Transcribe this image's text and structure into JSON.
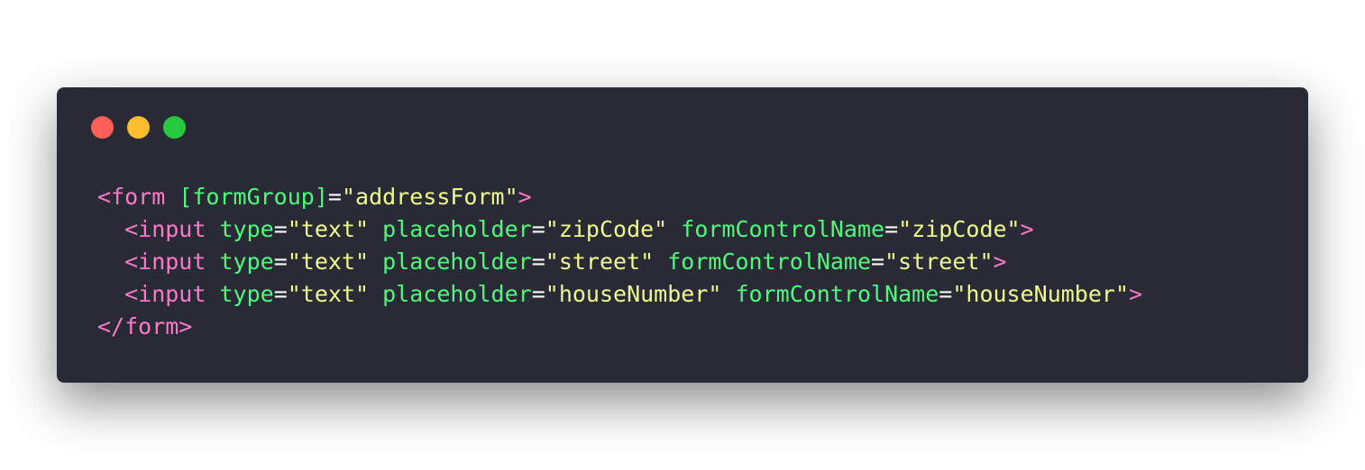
{
  "colors": {
    "background": "#ffffff",
    "window": "#282a36",
    "close": "#ff5f56",
    "minimize": "#ffbd2e",
    "maximize": "#27c93f",
    "tag": "#ff79c6",
    "attr": "#50fa7b",
    "string": "#f1fa8c",
    "plain": "#f8f8f2"
  },
  "window_controls": [
    {
      "name": "close",
      "icon": "red-dot",
      "color": "#ff5f56"
    },
    {
      "name": "minimize",
      "icon": "yellow-dot",
      "color": "#ffbd2e"
    },
    {
      "name": "maximize",
      "icon": "green-dot",
      "color": "#27c93f"
    }
  ],
  "code": {
    "lines": [
      {
        "indent": false,
        "tokens": [
          {
            "type": "tag",
            "text": "<form"
          },
          {
            "type": "plain",
            "text": " "
          },
          {
            "type": "attr",
            "text": "[formGroup]"
          },
          {
            "type": "plain",
            "text": "="
          },
          {
            "type": "string",
            "text": "\"addressForm\""
          },
          {
            "type": "tag",
            "text": ">"
          }
        ]
      },
      {
        "indent": true,
        "tokens": [
          {
            "type": "tag",
            "text": "<input"
          },
          {
            "type": "plain",
            "text": " "
          },
          {
            "type": "attr",
            "text": "type"
          },
          {
            "type": "plain",
            "text": "="
          },
          {
            "type": "string",
            "text": "\"text\""
          },
          {
            "type": "plain",
            "text": " "
          },
          {
            "type": "attr",
            "text": "placeholder"
          },
          {
            "type": "plain",
            "text": "="
          },
          {
            "type": "string",
            "text": "\"zipCode\""
          },
          {
            "type": "plain",
            "text": " "
          },
          {
            "type": "attr",
            "text": "formControlName"
          },
          {
            "type": "plain",
            "text": "="
          },
          {
            "type": "string",
            "text": "\"zipCode\""
          },
          {
            "type": "tag",
            "text": ">"
          }
        ]
      },
      {
        "indent": true,
        "tokens": [
          {
            "type": "tag",
            "text": "<input"
          },
          {
            "type": "plain",
            "text": " "
          },
          {
            "type": "attr",
            "text": "type"
          },
          {
            "type": "plain",
            "text": "="
          },
          {
            "type": "string",
            "text": "\"text\""
          },
          {
            "type": "plain",
            "text": " "
          },
          {
            "type": "attr",
            "text": "placeholder"
          },
          {
            "type": "plain",
            "text": "="
          },
          {
            "type": "string",
            "text": "\"street\""
          },
          {
            "type": "plain",
            "text": " "
          },
          {
            "type": "attr",
            "text": "formControlName"
          },
          {
            "type": "plain",
            "text": "="
          },
          {
            "type": "string",
            "text": "\"street\""
          },
          {
            "type": "tag",
            "text": ">"
          }
        ]
      },
      {
        "indent": true,
        "tokens": [
          {
            "type": "tag",
            "text": "<input"
          },
          {
            "type": "plain",
            "text": " "
          },
          {
            "type": "attr",
            "text": "type"
          },
          {
            "type": "plain",
            "text": "="
          },
          {
            "type": "string",
            "text": "\"text\""
          },
          {
            "type": "plain",
            "text": " "
          },
          {
            "type": "attr",
            "text": "placeholder"
          },
          {
            "type": "plain",
            "text": "="
          },
          {
            "type": "string",
            "text": "\"houseNumber\""
          },
          {
            "type": "plain",
            "text": " "
          },
          {
            "type": "attr",
            "text": "formControlName"
          },
          {
            "type": "plain",
            "text": "="
          },
          {
            "type": "string",
            "text": "\"houseNumber\""
          },
          {
            "type": "tag",
            "text": ">"
          }
        ]
      },
      {
        "indent": false,
        "tokens": [
          {
            "type": "tag",
            "text": "</form>"
          }
        ]
      }
    ]
  }
}
